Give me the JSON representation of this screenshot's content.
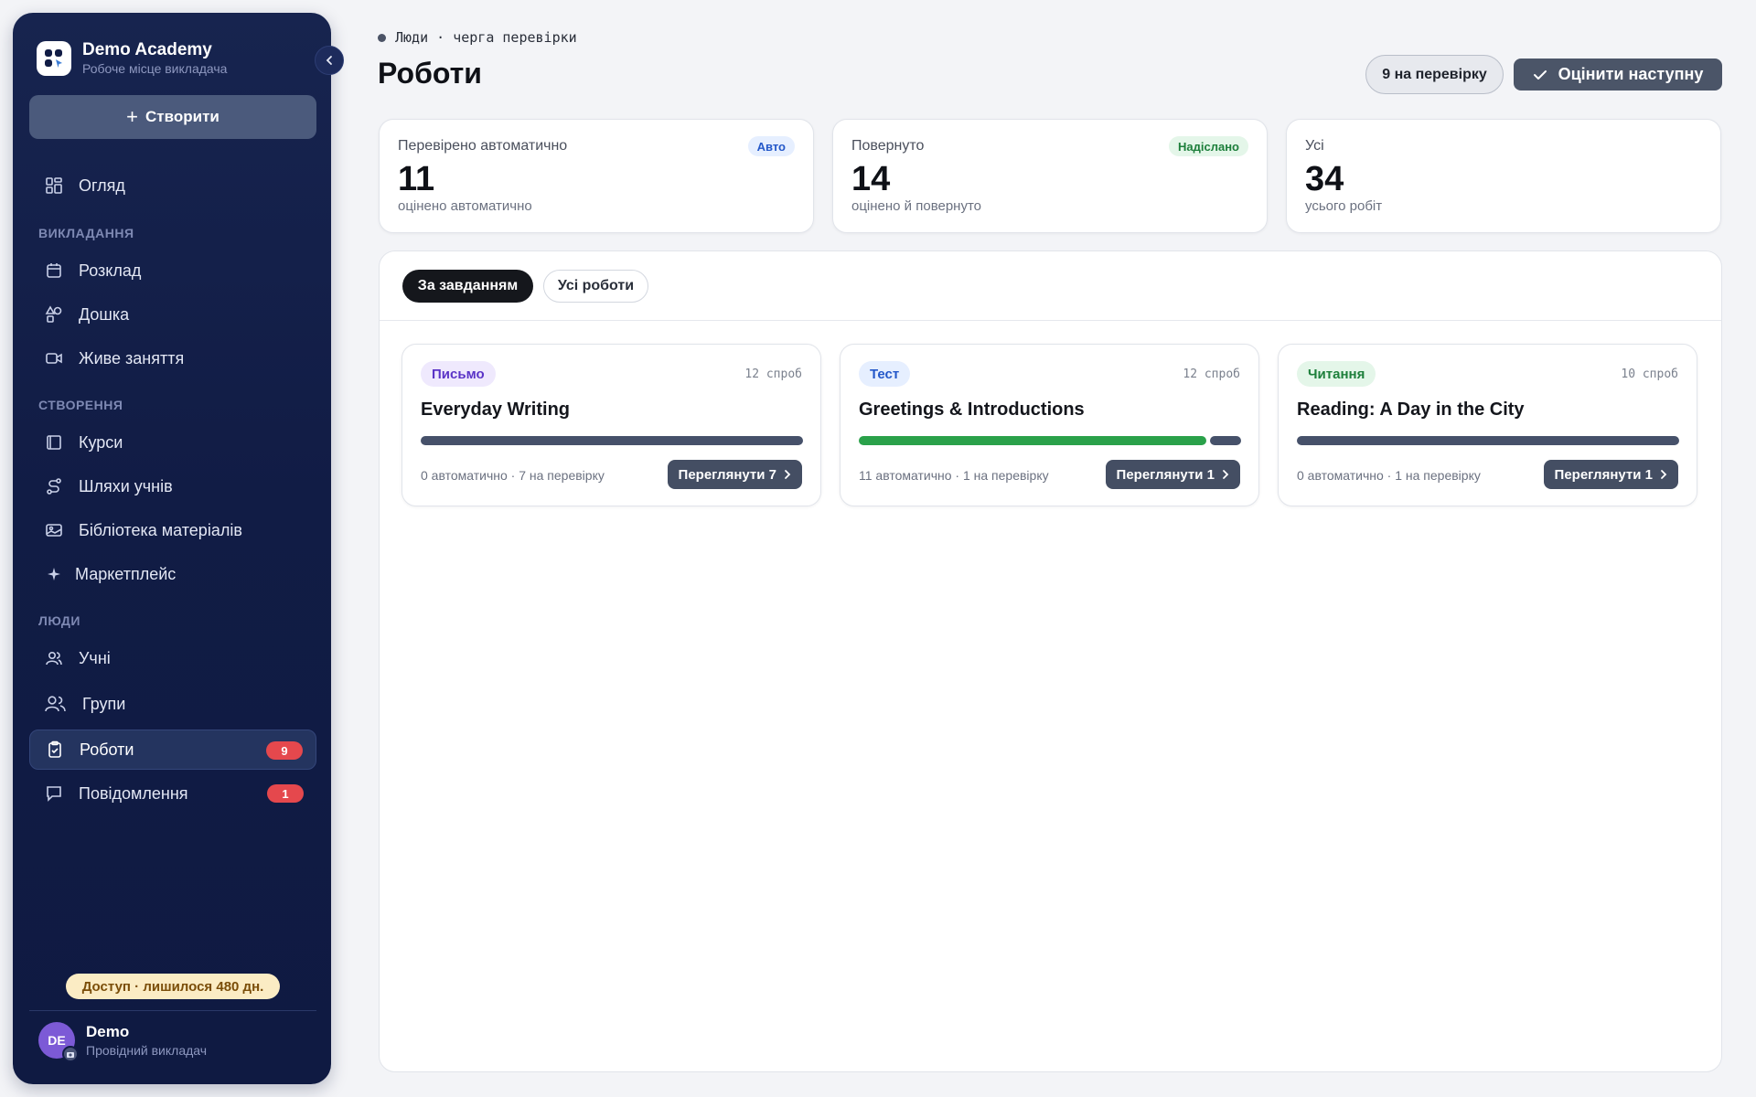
{
  "sidebar": {
    "brand_name": "Demo Academy",
    "brand_sub": "Робоче місце викладача",
    "create_label": "Створити",
    "items": {
      "overview": "Огляд",
      "schedule": "Розклад",
      "board": "Дошка",
      "live": "Живе заняття",
      "courses": "Курси",
      "paths": "Шляхи учнів",
      "library": "Бібліотека матеріалів",
      "marketplace": "Маркетплейс",
      "students": "Учні",
      "groups": "Групи",
      "works": "Роботи",
      "messages": "Повідомлення"
    },
    "sections": {
      "teaching": "ВИКЛАДАННЯ",
      "creation": "СТВОРЕННЯ",
      "people": "ЛЮДИ"
    },
    "badges": {
      "works": "9",
      "messages": "1"
    },
    "access": "Доступ · лишилося 480 дн.",
    "user": {
      "initials": "DE",
      "name": "Demo",
      "role": "Провідний викладач"
    }
  },
  "header": {
    "breadcrumb": "Люди · черга перевірки",
    "title": "Роботи",
    "pending_label": "9 на перевірку",
    "grade_next_label": "Оцінити наступну"
  },
  "stats": [
    {
      "label": "Перевірено автоматично",
      "value": "11",
      "sub": "оцінено автоматично",
      "tag": "Авто"
    },
    {
      "label": "Повернуто",
      "value": "14",
      "sub": "оцінено й повернуто",
      "tag": "Надіслано"
    },
    {
      "label": "Усі",
      "value": "34",
      "sub": "усього робіт",
      "tag": ""
    }
  ],
  "tabs": {
    "by_task": "За завданням",
    "all": "Усі роботи"
  },
  "cards": [
    {
      "type": "Письмо",
      "attempts": "12 спроб",
      "title": "Everyday Writing",
      "auto": 0,
      "review": 7,
      "meta": "0 автоматично · 7 на перевірку",
      "button": "Переглянути 7"
    },
    {
      "type": "Тест",
      "attempts": "12 спроб",
      "title": "Greetings & Introductions",
      "auto": 11,
      "review": 1,
      "meta": "11 автоматично · 1 на перевірку",
      "button": "Переглянути 1"
    },
    {
      "type": "Читання",
      "attempts": "10 спроб",
      "title": "Reading: A Day in the City",
      "auto": 0,
      "review": 1,
      "meta": "0 автоматично · 1 на перевірку",
      "button": "Переглянути 1"
    }
  ],
  "colors": {
    "sidebar_bg": "#111c45",
    "accent_red": "#e5484d",
    "bar_auto": "#2aa14a",
    "bar_review": "#46516a",
    "button_dark": "#444e63"
  },
  "icons": {
    "brand": "app-grid-icon",
    "overview": "dashboard-icon",
    "schedule": "calendar-icon",
    "board": "shapes-icon",
    "live": "video-icon",
    "courses": "book-icon",
    "paths": "route-icon",
    "library": "image-library-icon",
    "marketplace": "sparkle-icon",
    "students": "user-icon",
    "groups": "users-icon",
    "works": "clipboard-check-icon",
    "messages": "message-icon"
  }
}
